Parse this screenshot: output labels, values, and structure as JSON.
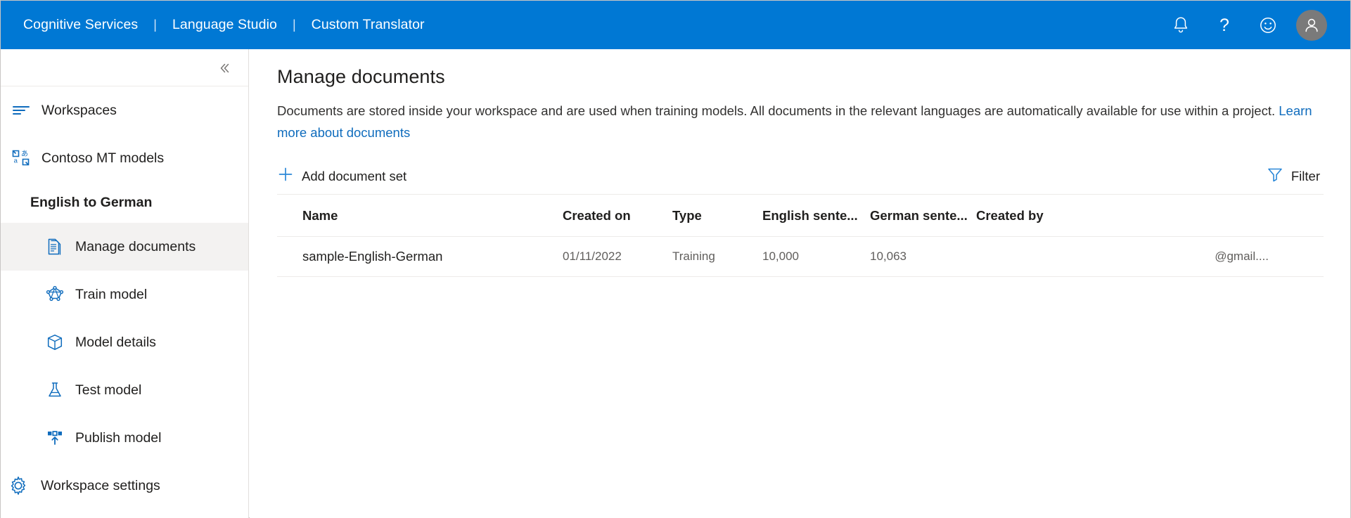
{
  "topbar": {
    "brand": [
      {
        "label": "Cognitive Services"
      },
      {
        "label": "Language Studio"
      },
      {
        "label": "Custom Translator"
      }
    ],
    "separator": "|",
    "icons": [
      {
        "name": "notifications-bell-icon"
      },
      {
        "name": "help-question-icon"
      },
      {
        "name": "feedback-smiley-icon"
      }
    ],
    "avatar": {
      "name": "user-avatar-icon"
    },
    "background_color": "#0078d4"
  },
  "sidebar": {
    "collapse": {
      "icon": "double-chevron-left-icon"
    },
    "items": [
      {
        "label": "Workspaces",
        "icon": "workspaces-list-icon",
        "indent": false,
        "selected": false
      },
      {
        "label": "Contoso MT models",
        "icon": "translate-icon",
        "indent": false,
        "selected": false
      }
    ],
    "section_title": "English to German",
    "project_items": [
      {
        "label": "Manage documents",
        "icon": "document-icon",
        "selected": true
      },
      {
        "label": "Train model",
        "icon": "neural-network-icon",
        "selected": false
      },
      {
        "label": "Model details",
        "icon": "package-box-icon",
        "selected": false
      },
      {
        "label": "Test model",
        "icon": "flask-beaker-icon",
        "selected": false
      },
      {
        "label": "Publish model",
        "icon": "publish-upload-icon",
        "selected": false
      }
    ],
    "settings_item": {
      "label": "Workspace settings",
      "icon": "gear-icon"
    },
    "accent_color": "#0f6cbd",
    "selected_background": "#f3f2f1"
  },
  "main": {
    "title": "Manage documents",
    "description_part1": "Documents are stored inside your workspace and are used when training models. All documents in the relevant languages are automatically available for use within a project. ",
    "description_link": "Learn more about documents",
    "toolbar": {
      "add_label": "Add document set",
      "add_icon": "plus-icon",
      "filter_label": "Filter",
      "filter_icon": "funnel-filter-icon"
    },
    "table": {
      "columns": [
        "Name",
        "Created on",
        "Type",
        "English sente...",
        "German sente...",
        "Created by"
      ],
      "rows": [
        {
          "name": "sample-English-German",
          "created_on": "01/11/2022",
          "type": "Training",
          "english_sentences": "10,000",
          "german_sentences": "10,063",
          "created_by": "@gmail...."
        }
      ]
    }
  }
}
